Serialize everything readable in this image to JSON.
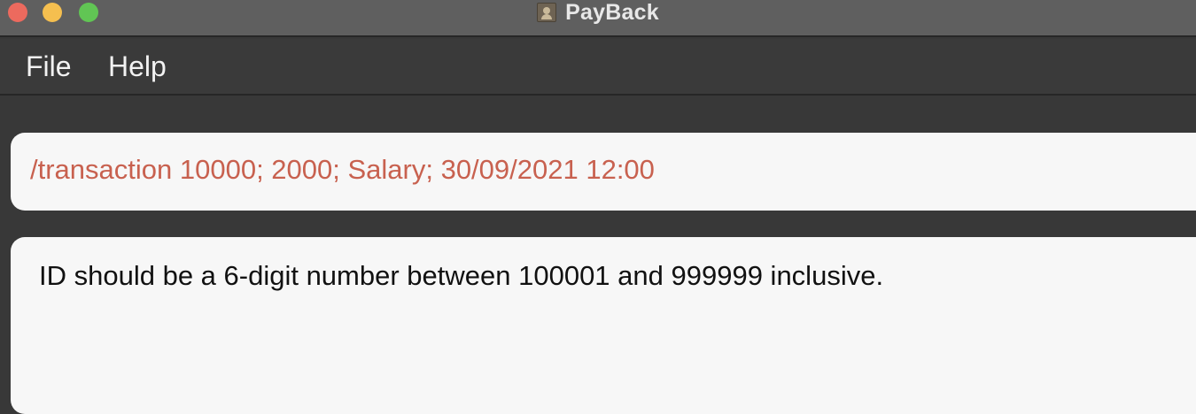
{
  "window": {
    "title": "PayBack",
    "app_icon": "contact-card-icon"
  },
  "menu": {
    "items": [
      {
        "label": "File"
      },
      {
        "label": "Help"
      }
    ]
  },
  "command_box": {
    "value": "/transaction 10000; 2000; Salary; 30/09/2021 12:00",
    "text_color": "#c8614f"
  },
  "result_display": {
    "message": "ID should be a 6-digit number between 100001 and 999999 inclusive."
  },
  "colors": {
    "background": "#383838",
    "titlebar": "#5f5f5f",
    "panel": "#f7f7f7",
    "close": "#ec6a5e",
    "minimize": "#f5bf4f",
    "maximize": "#61c554"
  }
}
